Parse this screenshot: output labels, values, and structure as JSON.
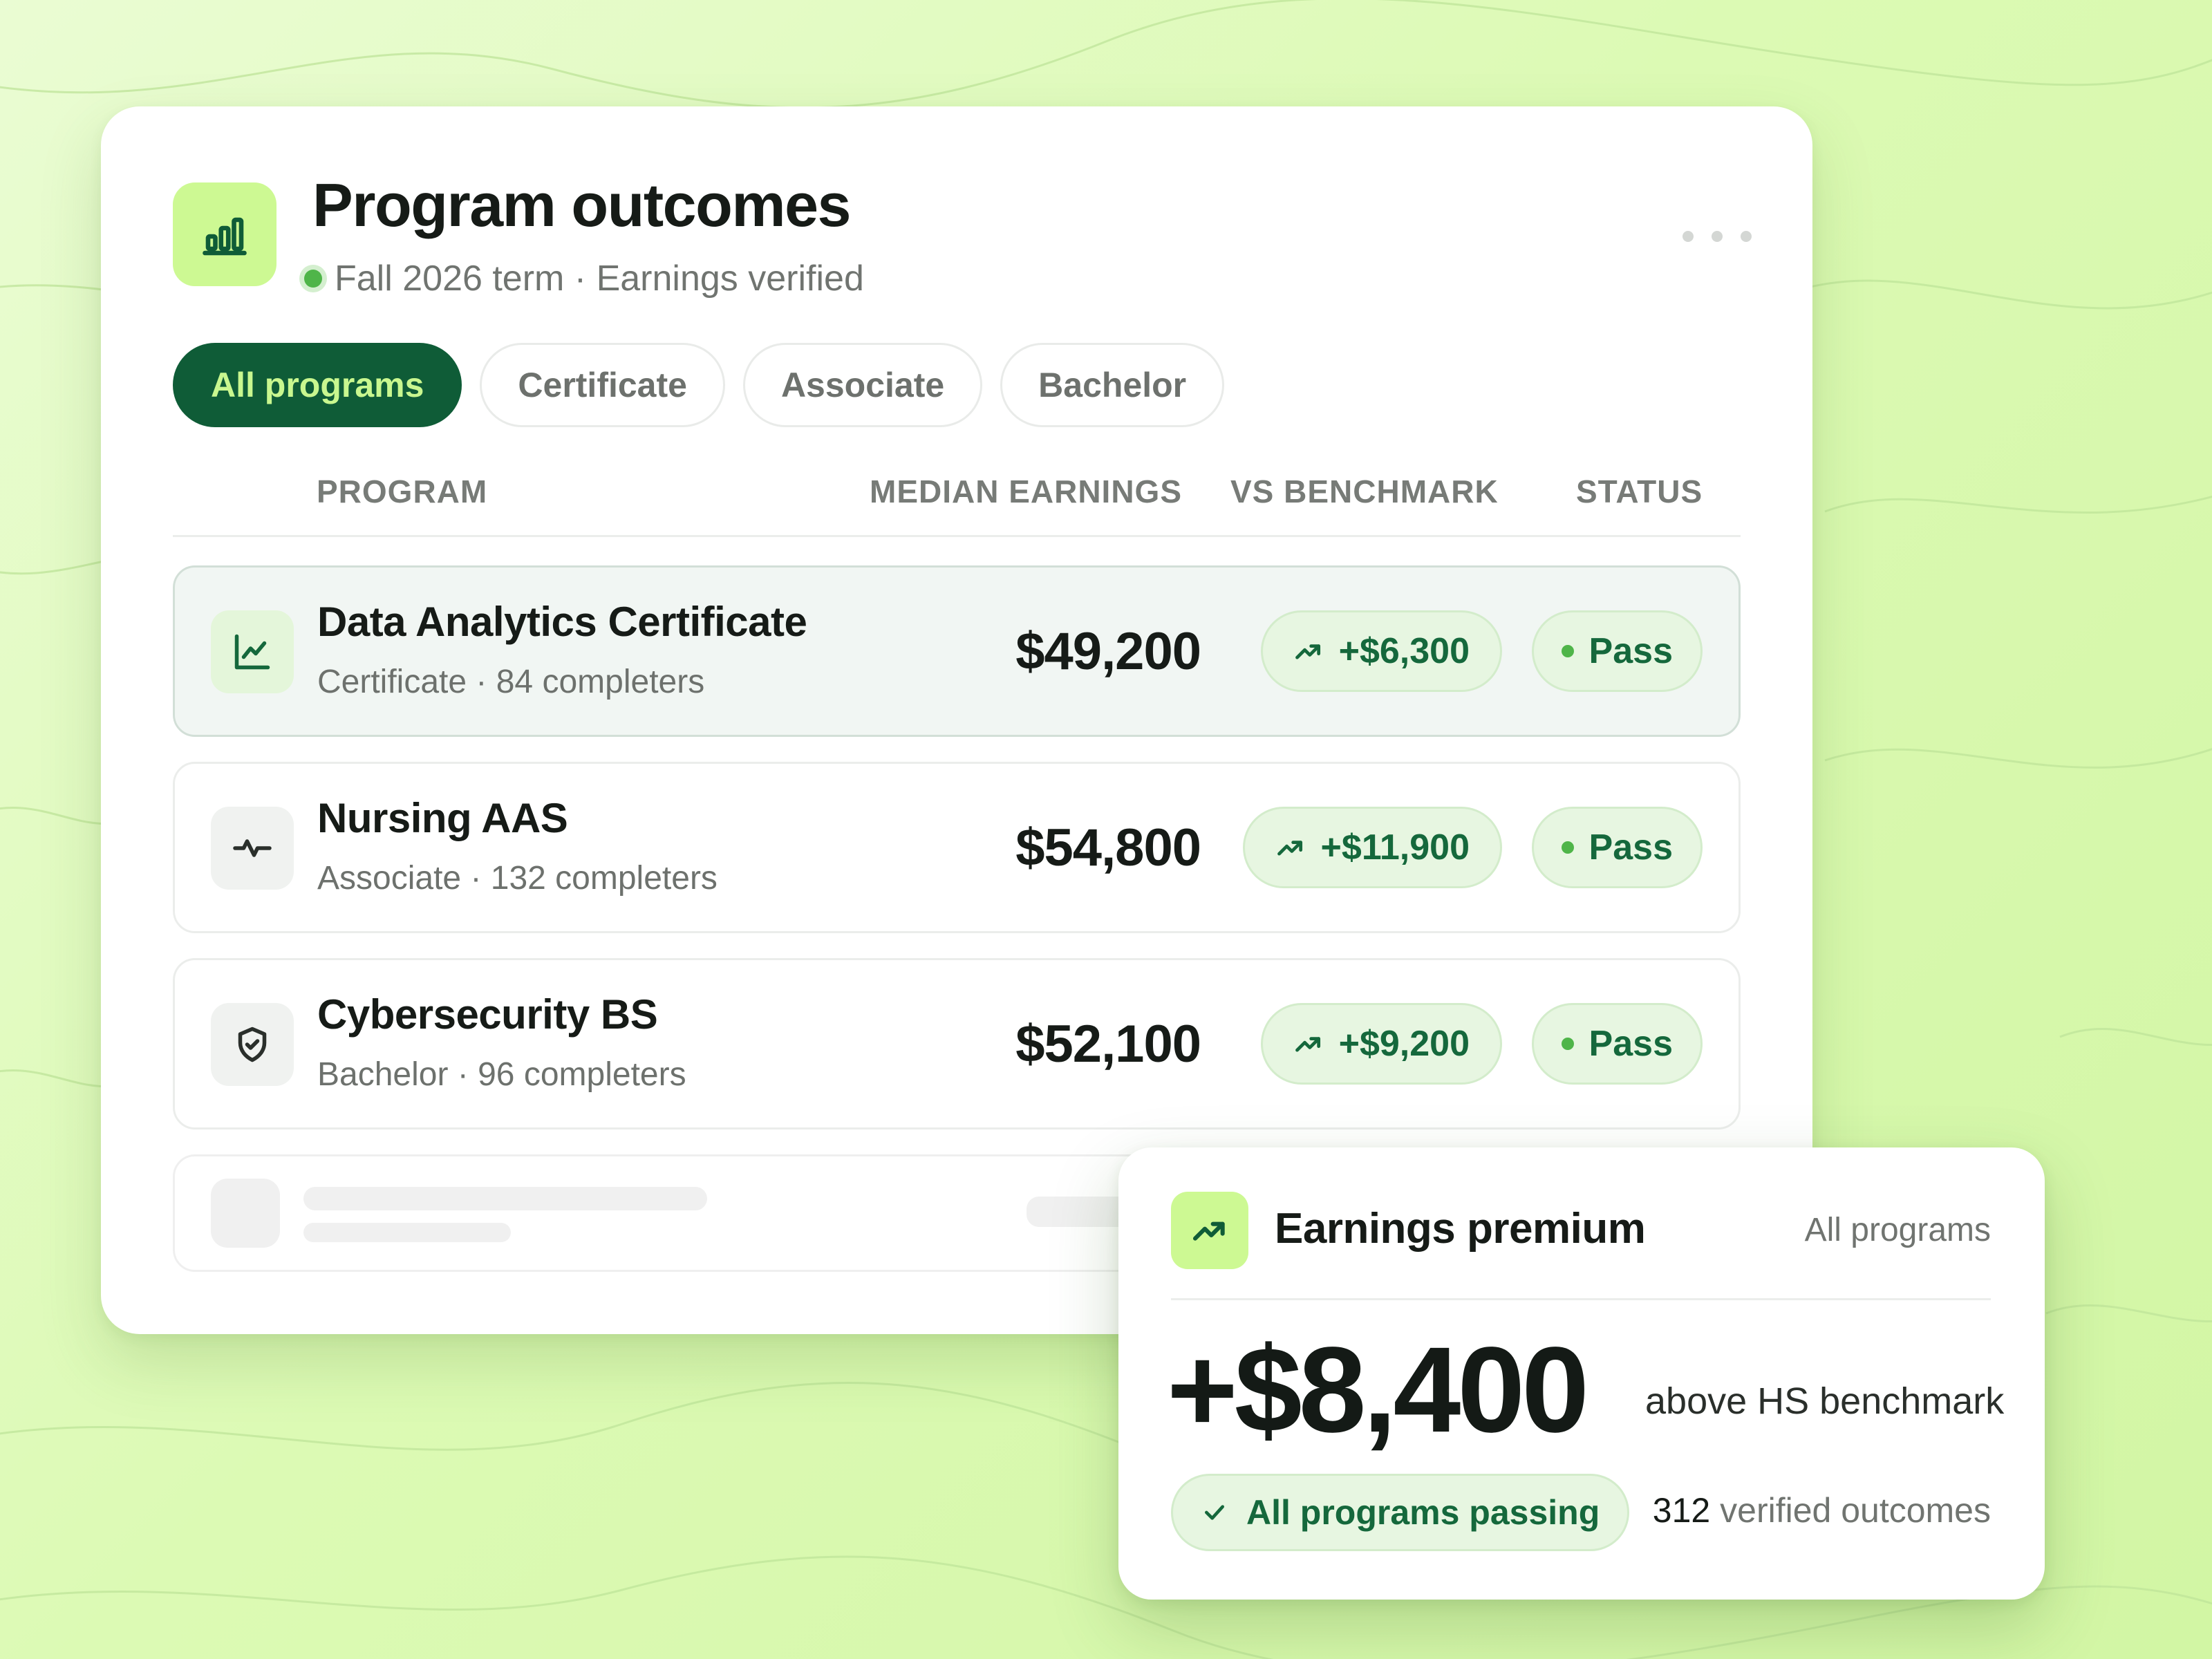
{
  "header": {
    "title": "Program outcomes",
    "subtitle": "Fall 2026 term · Earnings verified"
  },
  "tabs": [
    {
      "label": "All programs",
      "active": true
    },
    {
      "label": "Certificate",
      "active": false
    },
    {
      "label": "Associate",
      "active": false
    },
    {
      "label": "Bachelor",
      "active": false
    }
  ],
  "table": {
    "columns": [
      "PROGRAM",
      "MEDIAN EARNINGS",
      "VS BENCHMARK",
      "STATUS"
    ],
    "rows": [
      {
        "name": "Data Analytics Certificate",
        "meta": "Certificate · 84 completers",
        "earnings": "$49,200",
        "delta": "+$6,300",
        "status": "Pass",
        "icon": "line-chart-icon",
        "selected": true
      },
      {
        "name": "Nursing AAS",
        "meta": "Associate · 132 completers",
        "earnings": "$54,800",
        "delta": "+$11,900",
        "status": "Pass",
        "icon": "pulse-icon",
        "selected": false
      },
      {
        "name": "Cybersecurity BS",
        "meta": "Bachelor · 96 completers",
        "earnings": "$52,100",
        "delta": "+$9,200",
        "status": "Pass",
        "icon": "shield-check-icon",
        "selected": false
      }
    ]
  },
  "summary": {
    "title": "Earnings premium",
    "scope": "All programs",
    "value": "+$8,400",
    "value_label": "above HS benchmark",
    "pill": "All programs passing",
    "count": "312",
    "count_label": "verified outcomes"
  },
  "colors": {
    "background": "#dcfab4",
    "accent": "#0f5c37",
    "accent_light": "#cdf993",
    "success": "#15683c",
    "success_bg": "#e7f6e1"
  }
}
